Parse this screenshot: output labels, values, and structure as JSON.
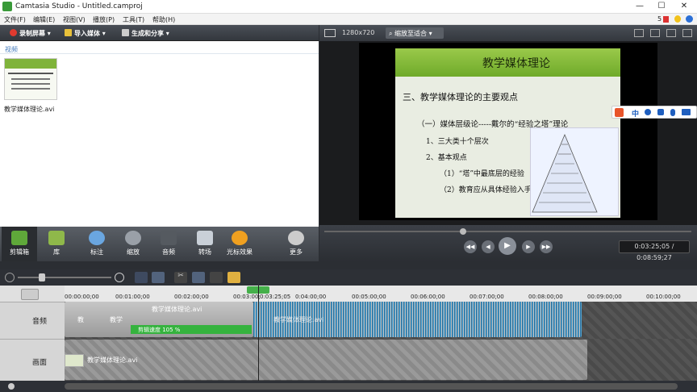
{
  "window": {
    "title": "Camtasia Studio - Untitled.camproj",
    "min": "—",
    "max": "☐",
    "close": "✕"
  },
  "menu": [
    "文件(F)",
    "编辑(E)",
    "视图(V)",
    "播放(P)",
    "工具(T)",
    "帮助(H)"
  ],
  "tray": {
    "count": "5"
  },
  "toolbar": {
    "record": "录制屏幕",
    "import": "导入媒体",
    "produce": "生成和分享"
  },
  "clipbin": {
    "header": "视频",
    "clip_name": "教学媒体理论.avi"
  },
  "tabs": [
    {
      "label": "剪辑箱",
      "color": "#5fa83a"
    },
    {
      "label": "库",
      "color": "#8fb84a"
    },
    {
      "label": "标注",
      "color": "#6aa6e0"
    },
    {
      "label": "缩放",
      "color": "#9aa0a8"
    },
    {
      "label": "音频",
      "color": "#555a60"
    },
    {
      "label": "转场",
      "color": "#c9d0d8"
    },
    {
      "label": "光标效果",
      "color": "#f0a020"
    },
    {
      "label": "更多",
      "color": "#cccccc"
    }
  ],
  "preview": {
    "resolution": "1280x720",
    "zoom": "缩放至适合",
    "time": "0:03:25;05 / 0:08:59;27"
  },
  "slide": {
    "title": "教学媒体理论",
    "heading": "三、教学媒体理论的主要观点",
    "line1": "（一）媒体层级论-----戴尔的“经验之塔”理论",
    "line2": "1、三大类十个层次",
    "line3": "2、基本观点",
    "line4": "（1）“塔”中最底层的经验",
    "line5": "（2）教育应从具体经验入手"
  },
  "sogou": {
    "lang": "中"
  },
  "timeline": {
    "playhead": "0:03:25;05",
    "ticks": [
      "00:00:00;00",
      "00:01:00;00",
      "00:02:00;00",
      "00:03:00;00",
      "0:04:00;00",
      "00:05:00;00",
      "00:06:00;00",
      "00:07:00;00",
      "00:08:00;00",
      "00:09:00;00",
      "00:10:00;00"
    ],
    "audio_label": "音频",
    "video_label": "画面",
    "audio_clip": "教学媒体理论.avi",
    "audio_short1": "教",
    "audio_short2": "教学",
    "speed": "剪辑速度 105 %",
    "audio_clip2": "教学媒体理论.avi",
    "video_clip": "教学媒体理论.avi"
  }
}
